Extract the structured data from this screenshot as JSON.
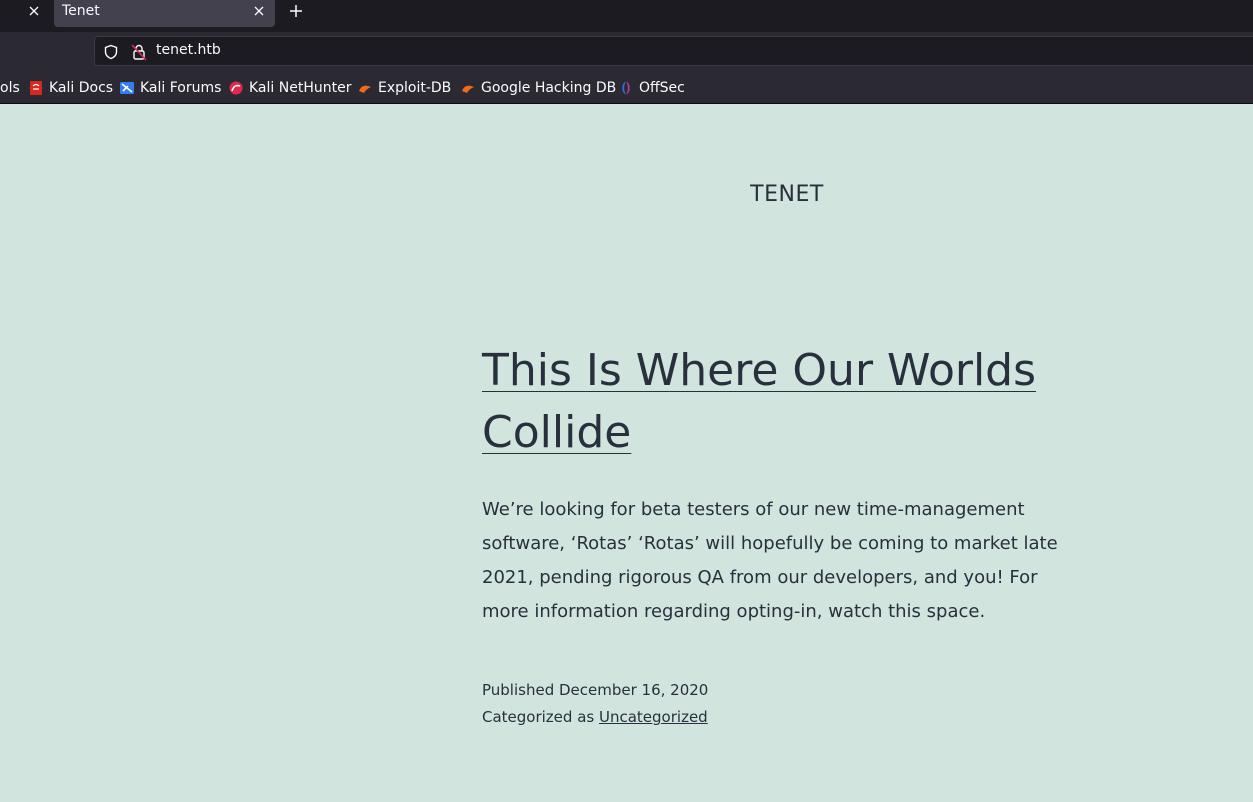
{
  "browser": {
    "tabs": [
      {
        "title": "",
        "active": false
      },
      {
        "title": "Tenet",
        "active": true
      }
    ],
    "url": "tenet.htb",
    "bookmarks": [
      {
        "label": "ols",
        "icon": "none"
      },
      {
        "label": "Kali Docs",
        "icon": "kali-docs-icon"
      },
      {
        "label": "Kali Forums",
        "icon": "kali-forums-icon"
      },
      {
        "label": "Kali NetHunter",
        "icon": "kali-nethunter-icon"
      },
      {
        "label": "Exploit-DB",
        "icon": "exploit-db-icon"
      },
      {
        "label": "Google Hacking DB",
        "icon": "google-hacking-db-icon"
      },
      {
        "label": "OffSec",
        "icon": "offsec-icon"
      }
    ]
  },
  "site": {
    "title": "TENET"
  },
  "post": {
    "title": "This Is Where Our Worlds Collide",
    "body": "We’re looking for beta testers of our new time-management software, ‘Rotas’ ‘Rotas’ will hopefully be coming to market late 2021, pending rigorous QA from our developers, and you! For more information regarding opting-in, watch this space.",
    "published_label": "Published",
    "published_date": "December 16, 2020",
    "categorized_label": "Categorized as",
    "category": "Uncategorized"
  },
  "colors": {
    "page_background": "#d1e4dd",
    "text": "#28303d",
    "chrome_dark": "#1c1b22",
    "chrome": "#2b2a33"
  }
}
